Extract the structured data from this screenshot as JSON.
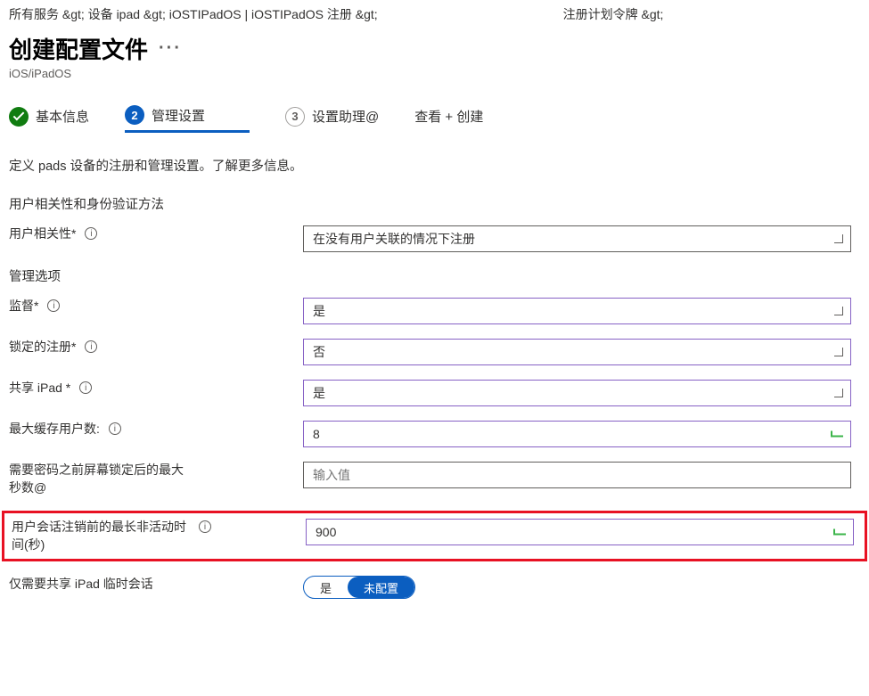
{
  "breadcrumb": {
    "part1": "所有服务 &gt;    设备 ipad &gt; iOSTIPadOS | iOSTIPadOS 注册 &gt;",
    "part2": "注册计划令牌 &gt;"
  },
  "page": {
    "title": "创建配置文件",
    "subtitle": "iOS/iPadOS"
  },
  "steps": {
    "s1": "基本信息",
    "s2": "管理设置",
    "s3_num": "3",
    "s3": "设置助理@",
    "s4": "查看 + 创建"
  },
  "description": "定义 pads 设备的注册和管理设置。了解更多信息。",
  "sections": {
    "auth": "用户相关性和身份验证方法",
    "mgmt": "管理选项"
  },
  "fields": {
    "user_affinity": {
      "label": "用户相关性*",
      "value": "在没有用户关联的情况下注册"
    },
    "supervised": {
      "label": "监督*",
      "value": "是"
    },
    "locked": {
      "label": "锁定的注册*",
      "value": "否"
    },
    "shared_ipad": {
      "label": "共享 iPad *",
      "value": "是"
    },
    "max_cached": {
      "label": "最大缓存用户数:",
      "value": "8"
    },
    "seconds_lock": {
      "label": "需要密码之前屏幕锁定后的最大秒数@",
      "placeholder": "输入值",
      "value": ""
    },
    "inactivity": {
      "label": "用户会话注销前的最长非活动时间(秒)",
      "value": "900"
    },
    "temp_only": {
      "label": "仅需要共享 iPad 临时会话",
      "opt_yes": "是",
      "opt_no": "未配置"
    }
  }
}
